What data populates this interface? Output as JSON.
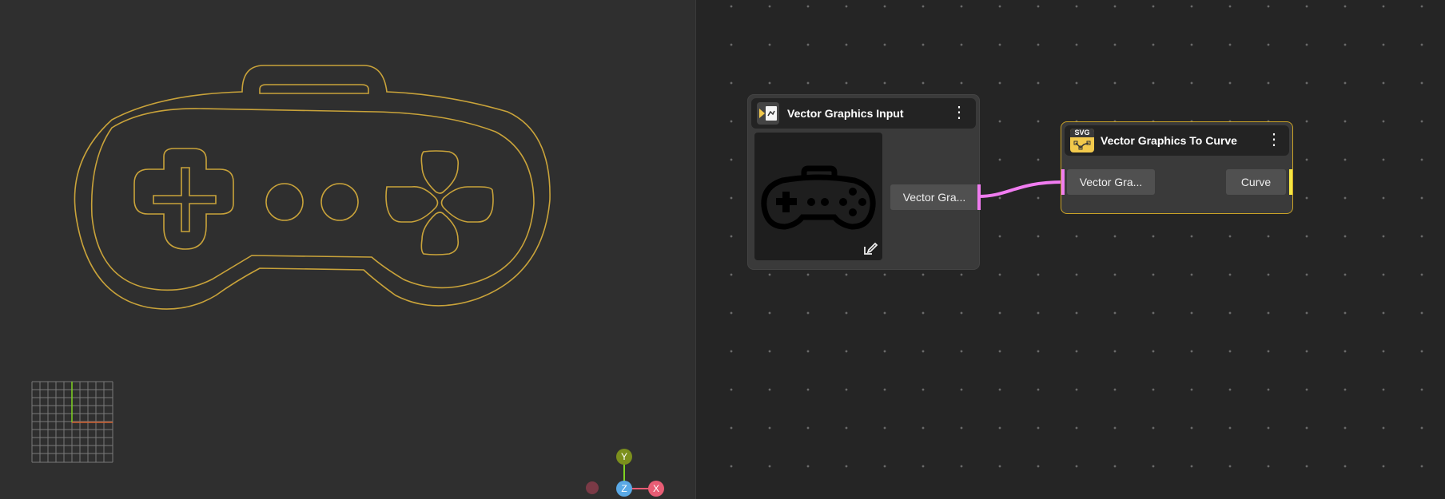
{
  "viewport": {
    "shape_color": "#c9a33a",
    "axes": {
      "y_label": "Y",
      "z_label": "Z",
      "x_label": "X",
      "y_color": "#7c8f1d",
      "z_color": "#5aa9e6",
      "x_color": "#e85d75"
    }
  },
  "graph": {
    "nodes": [
      {
        "title": "Vector Graphics Input",
        "icon": "vector-input-icon",
        "menu_glyph": "⋮",
        "output_port": {
          "label": "Vector Gra...",
          "color": "#f07cf0"
        },
        "edit_icon": "edit-icon"
      },
      {
        "title": "Vector Graphics To Curve",
        "icon_tag": "SVG",
        "icon": "svg-to-curve-icon",
        "menu_glyph": "⋮",
        "input_port": {
          "label": "Vector Gra...",
          "color": "#f07cf0"
        },
        "output_port": {
          "label": "Curve",
          "color": "#f5e642"
        },
        "accent": "#c9a227"
      }
    ],
    "link_color": "#f07cf0"
  }
}
